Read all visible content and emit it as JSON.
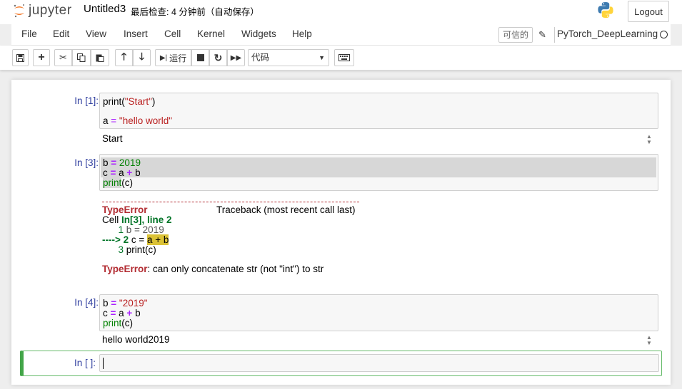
{
  "header": {
    "logo_text": "jupyter",
    "notebook_name": "Untitled3",
    "checkpoint": "最后检查: 4 分钟前（自动保存）",
    "logout_label": "Logout"
  },
  "menu": {
    "items": [
      "File",
      "Edit",
      "View",
      "Insert",
      "Cell",
      "Kernel",
      "Widgets",
      "Help"
    ],
    "trusted_label": "可信的",
    "kernel_name": "PyTorch_DeepLearning"
  },
  "toolbar": {
    "run_label": "运行",
    "cell_type": "代码"
  },
  "cells": [
    {
      "prompt": "In [1]:",
      "code": [
        "print(\"Start\")",
        "",
        "a = \"hello world\""
      ],
      "output": "Start"
    },
    {
      "prompt": "In [3]:",
      "code": [
        "b = 2019",
        "c = a + b",
        "print(c)"
      ],
      "traceback": {
        "error_name": "TypeError",
        "header_right": "Traceback (most recent call last)",
        "cell_label": "Cell ",
        "cell_ref": "In[3], line 2",
        "lines": [
          "      1 b = 2019",
          "----> 2 c = a + b",
          "      3 print(c)"
        ],
        "error_message": ": can only concatenate str (not \"int\") to str"
      }
    },
    {
      "prompt": "In [4]:",
      "code": [
        "b = \"2019\"",
        "c = a + b",
        "print(c)"
      ],
      "output": "hello world2019"
    },
    {
      "prompt": "In [ ]:",
      "code": [
        ""
      ]
    }
  ]
}
